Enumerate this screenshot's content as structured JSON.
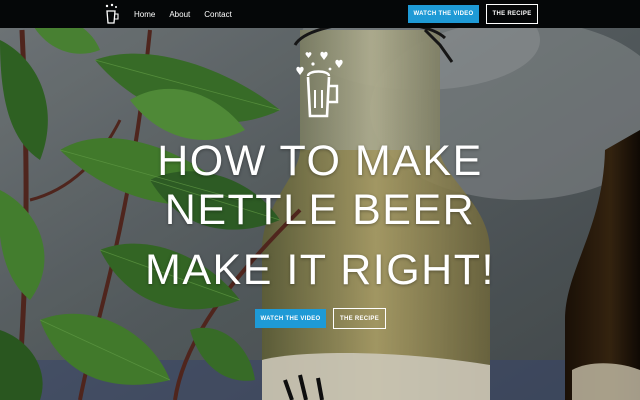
{
  "nav": {
    "logo_icon": "beer-mug-icon",
    "links": [
      "Home",
      "About",
      "Contact"
    ],
    "watch_video": "WATCH THE VIDEO",
    "recipe": "THE RECIPE"
  },
  "hero": {
    "icon": "beer-mug-hearts-icon",
    "title_line1": "HOW TO MAKE",
    "title_line2": "NETTLE BEER",
    "title_line3": "MAKE IT RIGHT!",
    "watch_video": "WATCH THE VIDEO",
    "recipe": "THE RECIPE",
    "background": "nettle-leaves-and-bottle-photo"
  },
  "colors": {
    "nav_bg": "#050708",
    "accent": "#1e9ad6",
    "text": "#ffffff"
  }
}
